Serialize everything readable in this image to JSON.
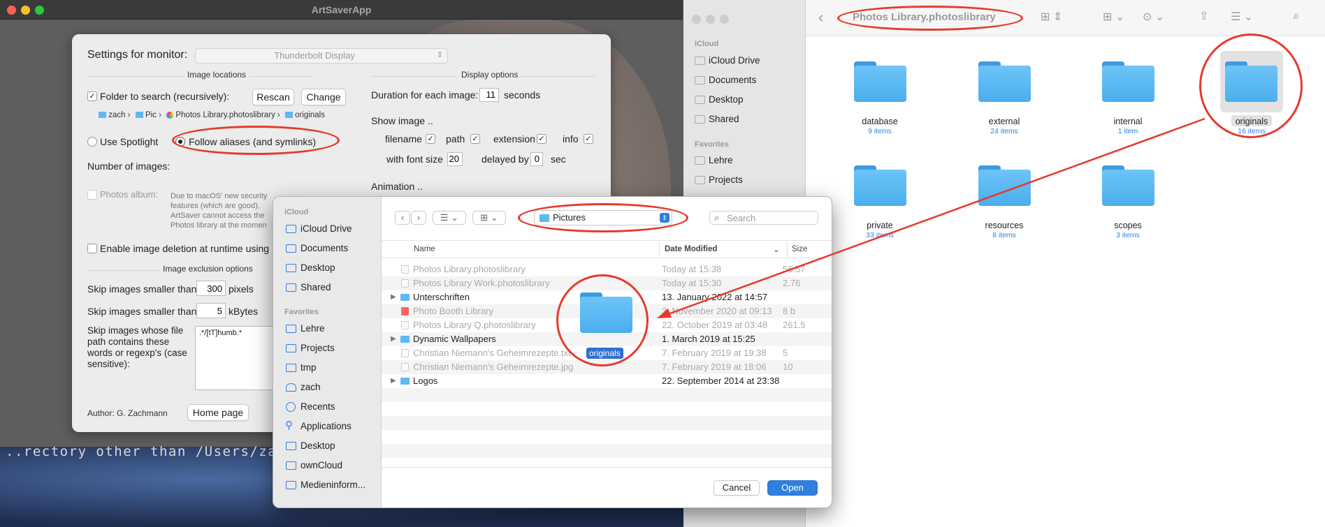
{
  "app_window": {
    "title": "ArtSaverApp",
    "terminal_text": "..rectory other than /Users/zach"
  },
  "settings": {
    "monitor_label": "Settings for monitor:",
    "monitor_value": "Thunderbolt Display",
    "image_locations_header": "Image locations",
    "folder_label": "Folder to search (recursively):",
    "rescan": "Rescan",
    "change": "Change",
    "path": [
      "zach",
      "Pic",
      "Photos Library.photoslibrary",
      "originals"
    ],
    "use_spotlight": "Use Spotlight",
    "follow_aliases": "Follow aliases (and symlinks)",
    "number_of_images": "Number of images:",
    "photos_album": "Photos album:",
    "security_note": [
      "Due to macOS' new security",
      "features (which are good),",
      "ArtSaver cannot access the",
      "Photos library at the momen"
    ],
    "enable_deletion": "Enable image deletion at runtime using D",
    "exclusion_header": "Image exclusion options",
    "skip_pixels_label": "Skip images smaller than",
    "skip_pixels_value": "300",
    "skip_pixels_unit": "pixels",
    "skip_kb_label": "Skip images smaller than",
    "skip_kb_value": "5",
    "skip_kb_unit": "kBytes",
    "skip_path_label": [
      "Skip images whose file",
      "path contains these",
      "words or regexp's (case",
      "sensitive):"
    ],
    "skip_path_value": ".*/[tT]humb.*",
    "author": "Author: G. Zachmann",
    "home_page": "Home page",
    "display_options_header": "Display options",
    "duration_label": "Duration for each image:",
    "duration_value": "11",
    "duration_unit": "seconds",
    "show_image": "Show image ..",
    "opt_filename": "filename",
    "opt_path": "path",
    "opt_extension": "extension",
    "opt_info": "info",
    "font_size_label": "with font size",
    "font_size_value": "20",
    "delayed_label": "delayed by",
    "delayed_value": "0",
    "delayed_unit": "sec",
    "animation": "Animation .."
  },
  "dialog": {
    "sidebar_icloud": "iCloud",
    "icloud_items": [
      "iCloud Drive",
      "Documents",
      "Desktop",
      "Shared"
    ],
    "sidebar_favorites": "Favorites",
    "favorite_items": [
      "Lehre",
      "Projects",
      "tmp",
      "zach",
      "Recents",
      "Applications",
      "Desktop",
      "ownCloud",
      "Medieninform..."
    ],
    "location": "Pictures",
    "search_placeholder": "Search",
    "col_name": "Name",
    "col_date": "Date Modified",
    "col_size": "Size",
    "rows": [
      {
        "name": "Photos Library.photoslibrary",
        "date": "Today at 15:38",
        "size": "56.57",
        "enabled": false
      },
      {
        "name": "Photos Library Work.photoslibrary",
        "date": "Today at 15:30",
        "size": "2.76",
        "enabled": false
      },
      {
        "name": "Unterschriften",
        "date": "13. January 2022 at 14:57",
        "size": "",
        "enabled": true
      },
      {
        "name": "Photo Booth Library",
        "date": "3. November 2020 at 09:13",
        "size": "8 b",
        "enabled": false
      },
      {
        "name": "Photos Library Q.photoslibrary",
        "date": "22. October 2019 at 03:48",
        "size": "261.5",
        "enabled": false
      },
      {
        "name": "Dynamic Wallpapers",
        "date": "1. March 2019 at 15:25",
        "size": "",
        "enabled": true
      },
      {
        "name": "Christian Niemann's Geheimrezepte.txt",
        "date": "7. February 2019 at 19:38",
        "size": "5",
        "enabled": false
      },
      {
        "name": "Christian Niemann's Geheimrezepte.jpg",
        "date": "7. February 2019 at 18:06",
        "size": "10",
        "enabled": false
      },
      {
        "name": "Logos",
        "date": "22. September 2014 at 23:38",
        "size": "",
        "enabled": true
      }
    ],
    "drag_label": "originals",
    "cancel": "Cancel",
    "open": "Open"
  },
  "finder": {
    "title": "Photos Library.photoslibrary",
    "sidebar_icloud": "iCloud",
    "icloud_items": [
      "iCloud Drive",
      "Documents",
      "Desktop",
      "Shared"
    ],
    "sidebar_favorites": "Favorites",
    "favorite_items": [
      "Lehre",
      "Projects"
    ],
    "folders": [
      {
        "name": "database",
        "count": "9 items"
      },
      {
        "name": "external",
        "count": "24 items"
      },
      {
        "name": "internal",
        "count": "1 item"
      },
      {
        "name": "originals",
        "count": "16 items"
      },
      {
        "name": "private",
        "count": "33 items"
      },
      {
        "name": "resources",
        "count": "8 items"
      },
      {
        "name": "scopes",
        "count": "3 items"
      }
    ]
  },
  "colors": {
    "annotation": "#e53a2c",
    "accent": "#2f7fe0",
    "folder": "#5fb8f3"
  }
}
